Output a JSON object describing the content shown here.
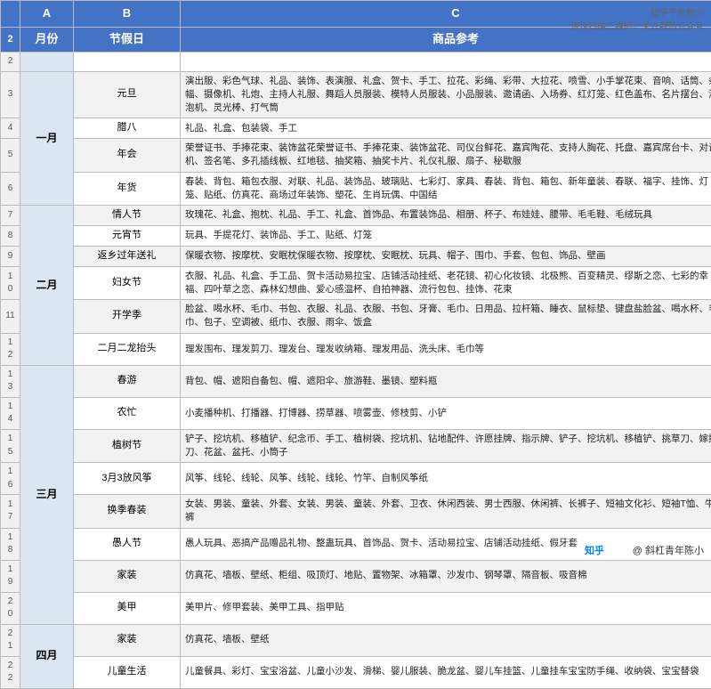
{
  "watermark": {
    "line1": "知乎千年包少",
    "line2": "进也扫描二维码，关注我的公众号"
  },
  "zhihu": "知乎",
  "author": "@ 斜杠青年陈小",
  "col_headers": [
    "月份",
    "节假日",
    "商品参考"
  ],
  "col_letters": [
    "A",
    "B",
    "C"
  ],
  "rows": [
    {
      "num": "2",
      "month": "",
      "holiday": "",
      "goods": "",
      "is_col_header": true
    },
    {
      "num": "3",
      "month": "一月",
      "holiday": "元旦",
      "goods": "演出服、彩色气球、礼品、装饰、表演服、礼盒、贺卡、手工、拉花、彩绳、彩带、大拉花、喷雪、小手掌花束、音响、话筒、条幅、摄像机、礼炮、主持人礼服、舞蹈人员服装、模特人员服装、小品服装、邀请函、入场券、红灯笼、红色盖布、名片摆台、泡泡机、灵光棒、打气筒"
    },
    {
      "num": "4",
      "month": "",
      "holiday": "腊八",
      "goods": "礼品、礼盒、包装袋、手工"
    },
    {
      "num": "5",
      "month": "",
      "holiday": "年会",
      "goods": "荣誉证书、手捧花束、装饰盆花荣誉证书、手捧花束、装饰盆花、司仪台鲜花、嘉宾陶花、支持人胸花、托盘、嘉宾席台卡、对讲机、签名笔、多孔插线板、红地毯、抽奖箱、抽奖卡片、礼仪礼服、扇子、秘歇服"
    },
    {
      "num": "6",
      "month": "",
      "holiday": "年货",
      "goods": "春装、背包、箱包衣服、对联、礼品、装饰品、玻璃贴、七彩灯、家具、春装、背包、箱包、新年童装、春联、福字、挂饰、灯笼、贴纸、仿真花、商场过年装饰、塑花、生肖玩偶、中国结"
    },
    {
      "num": "7",
      "month": "二月",
      "holiday": "情人节",
      "goods": "玫瑰花、礼盒、抱枕、礼品、手工、礼盒、首饰品、布置装饰品、相册、杯子、布娃娃、腰带、毛毛鞋、毛绒玩具"
    },
    {
      "num": "8",
      "month": "",
      "holiday": "元宵节",
      "goods": "玩具、手提花灯、装饰品、手工、贴纸、灯笼"
    },
    {
      "num": "9",
      "month": "",
      "holiday": "返乡过年送礼",
      "goods": "保暖衣物、按摩枕、安眠枕保暖衣物、按摩枕、安眠枕、玩具、帽子、围巾、手套、包包、饰品、壁画"
    },
    {
      "num": "10",
      "month": "",
      "holiday": "妇女节",
      "goods": "衣服、礼品、礼盒、手工品、贺卡活动易拉宝、店铺活动挂纸、老花镜、初心化妆镜、北极熊、百变精灵、缪斯之恋、七彩的幸福、四叶草之恋、森林幻想曲、爱心感温杯、自拍神器、流行包包、挂饰、花束"
    },
    {
      "num": "11",
      "month": "",
      "holiday": "开学季",
      "goods": "脸盆、喝水杯、毛巾、书包、衣服、礼品、衣服、书包、牙膏、毛巾、日用品、拉杆箱、睡衣、鼠标垫、键盘盐脸盆、喝水杯、毛巾、包子、空调被、纸巾、衣服、雨伞、饭盒"
    },
    {
      "num": "12",
      "month": "",
      "holiday": "二月二龙抬头",
      "goods": "理发围布、理发剪刀、理发台、理发收纳箱、理发用品、洗头床、毛巾等"
    },
    {
      "num": "13",
      "month": "三月",
      "holiday": "春游",
      "goods": "背包、帽、遮阳自备包、帽、遮阳伞、旅游鞋、墨镜、塑料瓶"
    },
    {
      "num": "14",
      "month": "",
      "holiday": "农忙",
      "goods": "小麦播种机、打播器、打博器、捞草器、喷雾壶、修枝剪、小铲"
    },
    {
      "num": "15",
      "month": "",
      "holiday": "植树节",
      "goods": "铲子、挖坑机、移植铲、纪念币、手工、植树袋、挖坑机、钻地配件、许愿挂牌、指示牌、铲子、挖坑机、移植铲、挑草刀、嫁接刀、花盆、盆托、小筒子"
    },
    {
      "num": "16",
      "month": "",
      "holiday": "3月3放风筝",
      "goods": "风筝、线轮、线轮、风筝、线轮、线轮、竹竿、自制风筝纸"
    },
    {
      "num": "17",
      "month": "",
      "holiday": "换季春装",
      "goods": "女装、男装、童装、外套、女装、男装、童装、外套、卫衣、休闲西装、男士西服、休闲裤、长裤子、短袖文化衫、短袖T恤、牛仔裤"
    },
    {
      "num": "18",
      "month": "",
      "holiday": "愚人节",
      "goods": "愚人玩具、恶搞产品赠品礼物、整蛊玩具、首饰品、贺卡、活动易拉宝、店铺活动挂纸、假牙套"
    },
    {
      "num": "19",
      "month": "",
      "holiday": "家装",
      "goods": "仿真花、墙板、壁纸、柜组、吸顶灯、地贴、置物架、冰箱罩、沙发巾、钢琴罩、隔音板、吸音棉"
    },
    {
      "num": "20",
      "month": "",
      "holiday": "美甲",
      "goods": "美甲片、修甲套装、美甲工具、指甲贴"
    },
    {
      "num": "21",
      "month": "四月",
      "holiday": "家装",
      "goods": "仿真花、墙板、壁纸"
    },
    {
      "num": "22",
      "month": "",
      "holiday": "儿童生活",
      "goods": "儿童餐具、彩灯、宝宝浴盆、儿童小沙发、滑梯、婴儿服装、脆龙盆、婴儿车挂篮、儿童挂车宝宝防手绳、收纳袋、宝宝替袋"
    }
  ]
}
